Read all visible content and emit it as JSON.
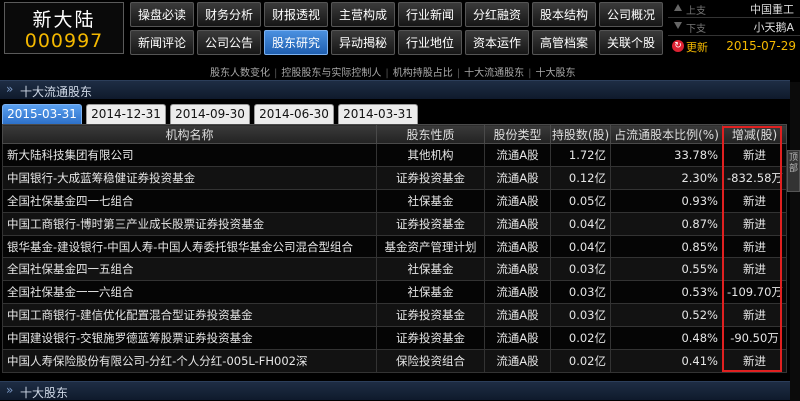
{
  "stock": {
    "name": "新大陆",
    "code": "000997"
  },
  "nav": {
    "row1": [
      "操盘必读",
      "财务分析",
      "财报透视",
      "主营构成",
      "行业新闻",
      "分红融资",
      "股本结构",
      "公司概况"
    ],
    "row2": [
      "新闻评论",
      "公司公告",
      "股东研究",
      "异动揭秘",
      "行业地位",
      "资本运作",
      "高管档案",
      "关联个股"
    ],
    "active": "股东研究"
  },
  "side": {
    "up_label": "上支",
    "up_value": "中国重工",
    "down_label": "下支",
    "down_value": "小天鹅A",
    "update_label": "更新",
    "update_date": "2015-07-29",
    "refresh_glyph": "↻"
  },
  "sections": {
    "top_circulating": "十大流通股东",
    "top_shareholders": "十大股东",
    "chevron": "»"
  },
  "sublinks": [
    "股东人数变化",
    "控股股东与实际控制人",
    "机构持股占比",
    "十大流通股东",
    "十大股东"
  ],
  "tabs": [
    "2015-03-31",
    "2014-12-31",
    "2014-09-30",
    "2014-06-30",
    "2014-03-31"
  ],
  "table": {
    "headers": [
      "机构名称",
      "股东性质",
      "股份类型",
      "持股数(股)",
      "占流通股本比例(%)",
      "增减(股)"
    ],
    "rows": [
      [
        "新大陆科技集团有限公司",
        "其他机构",
        "流通A股",
        "1.72亿",
        "33.78%",
        "新进"
      ],
      [
        "中国银行-大成蓝筹稳健证券投资基金",
        "证券投资基金",
        "流通A股",
        "0.12亿",
        "2.30%",
        "-832.58万"
      ],
      [
        "全国社保基金四一七组合",
        "社保基金",
        "流通A股",
        "0.05亿",
        "0.93%",
        "新进"
      ],
      [
        "中国工商银行-博时第三产业成长股票证券投资基金",
        "证券投资基金",
        "流通A股",
        "0.04亿",
        "0.87%",
        "新进"
      ],
      [
        "银华基金-建设银行-中国人寿-中国人寿委托银华基金公司混合型组合",
        "基金资产管理计划",
        "流通A股",
        "0.04亿",
        "0.85%",
        "新进"
      ],
      [
        "全国社保基金四一五组合",
        "社保基金",
        "流通A股",
        "0.03亿",
        "0.55%",
        "新进"
      ],
      [
        "全国社保基金一一六组合",
        "社保基金",
        "流通A股",
        "0.03亿",
        "0.53%",
        "-109.70万"
      ],
      [
        "中国工商银行-建信优化配置混合型证券投资基金",
        "证券投资基金",
        "流通A股",
        "0.03亿",
        "0.52%",
        "新进"
      ],
      [
        "中国建设银行-交银施罗德蓝筹股票证券投资基金",
        "证券投资基金",
        "流通A股",
        "0.02亿",
        "0.48%",
        "-90.50万"
      ],
      [
        "中国人寿保险股份有限公司-分红-个人分红-005L-FH002深",
        "保险投资组合",
        "流通A股",
        "0.02亿",
        "0.41%",
        "新进"
      ]
    ]
  },
  "scroll_tab": "顶部",
  "colors": {
    "accent": "#2d70c8",
    "code": "#f4b800",
    "highlight": "#e02020"
  }
}
